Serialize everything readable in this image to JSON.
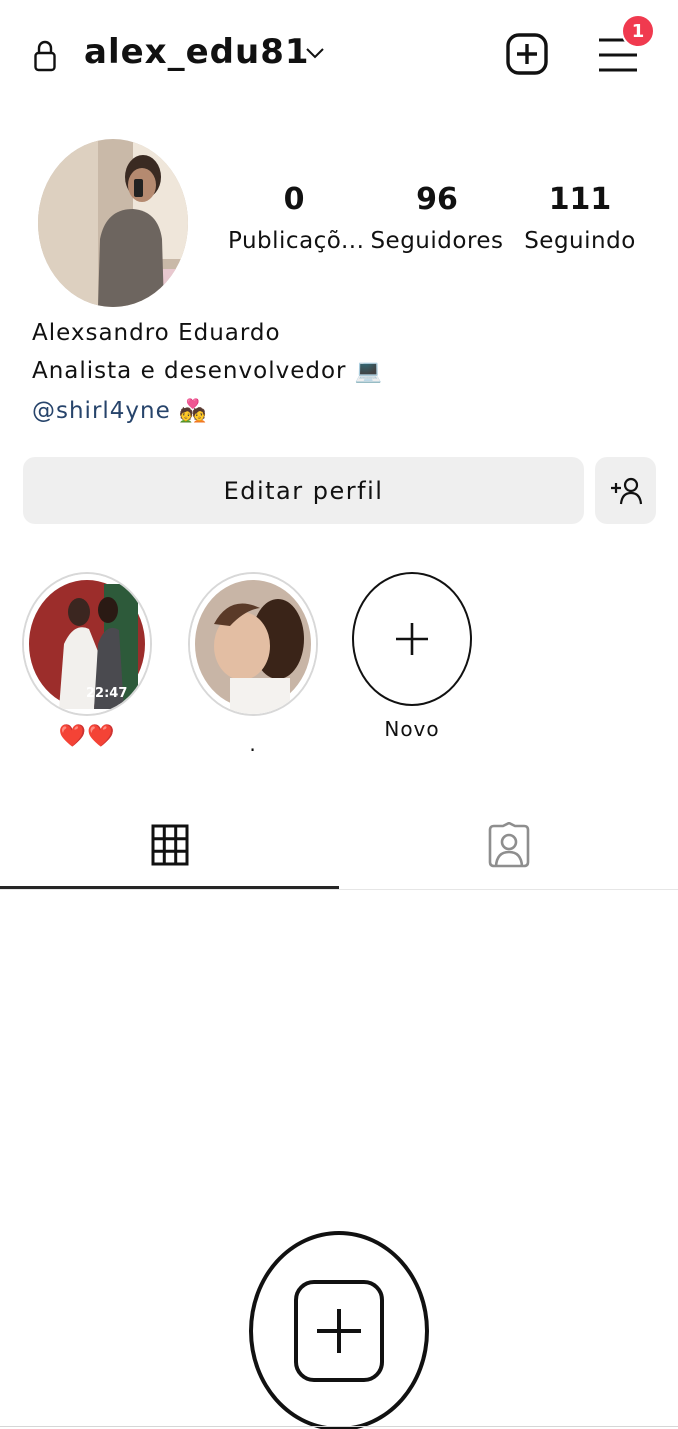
{
  "header": {
    "username": "alex_edu81",
    "notification_count": "1",
    "colors": {
      "badge": "#f03a4f"
    }
  },
  "profile": {
    "stats": [
      {
        "value": "0",
        "label": "Publicaçõ..."
      },
      {
        "value": "96",
        "label": "Seguidores"
      },
      {
        "value": "111",
        "label": "Seguindo"
      }
    ],
    "name": "Alexsandro Eduardo",
    "description": "Analista e desenvolvedor",
    "description_emoji": "💻",
    "link": "@shirl4yne",
    "link_emoji": "💑",
    "edit_button": "Editar perfil"
  },
  "highlights": [
    {
      "label": "❤️❤️",
      "overlay_text": "22:47"
    },
    {
      "label": "."
    },
    {
      "label": "Novo"
    }
  ],
  "tabs": [
    {
      "icon": "grid-icon",
      "active": true
    },
    {
      "icon": "tagged-person-icon",
      "active": false
    }
  ],
  "icons": [
    "lock-icon",
    "chevron-down-icon",
    "plus-square-icon",
    "hamburger-menu-icon",
    "add-person-icon",
    "plus-icon",
    "grid-icon",
    "tagged-person-icon"
  ]
}
